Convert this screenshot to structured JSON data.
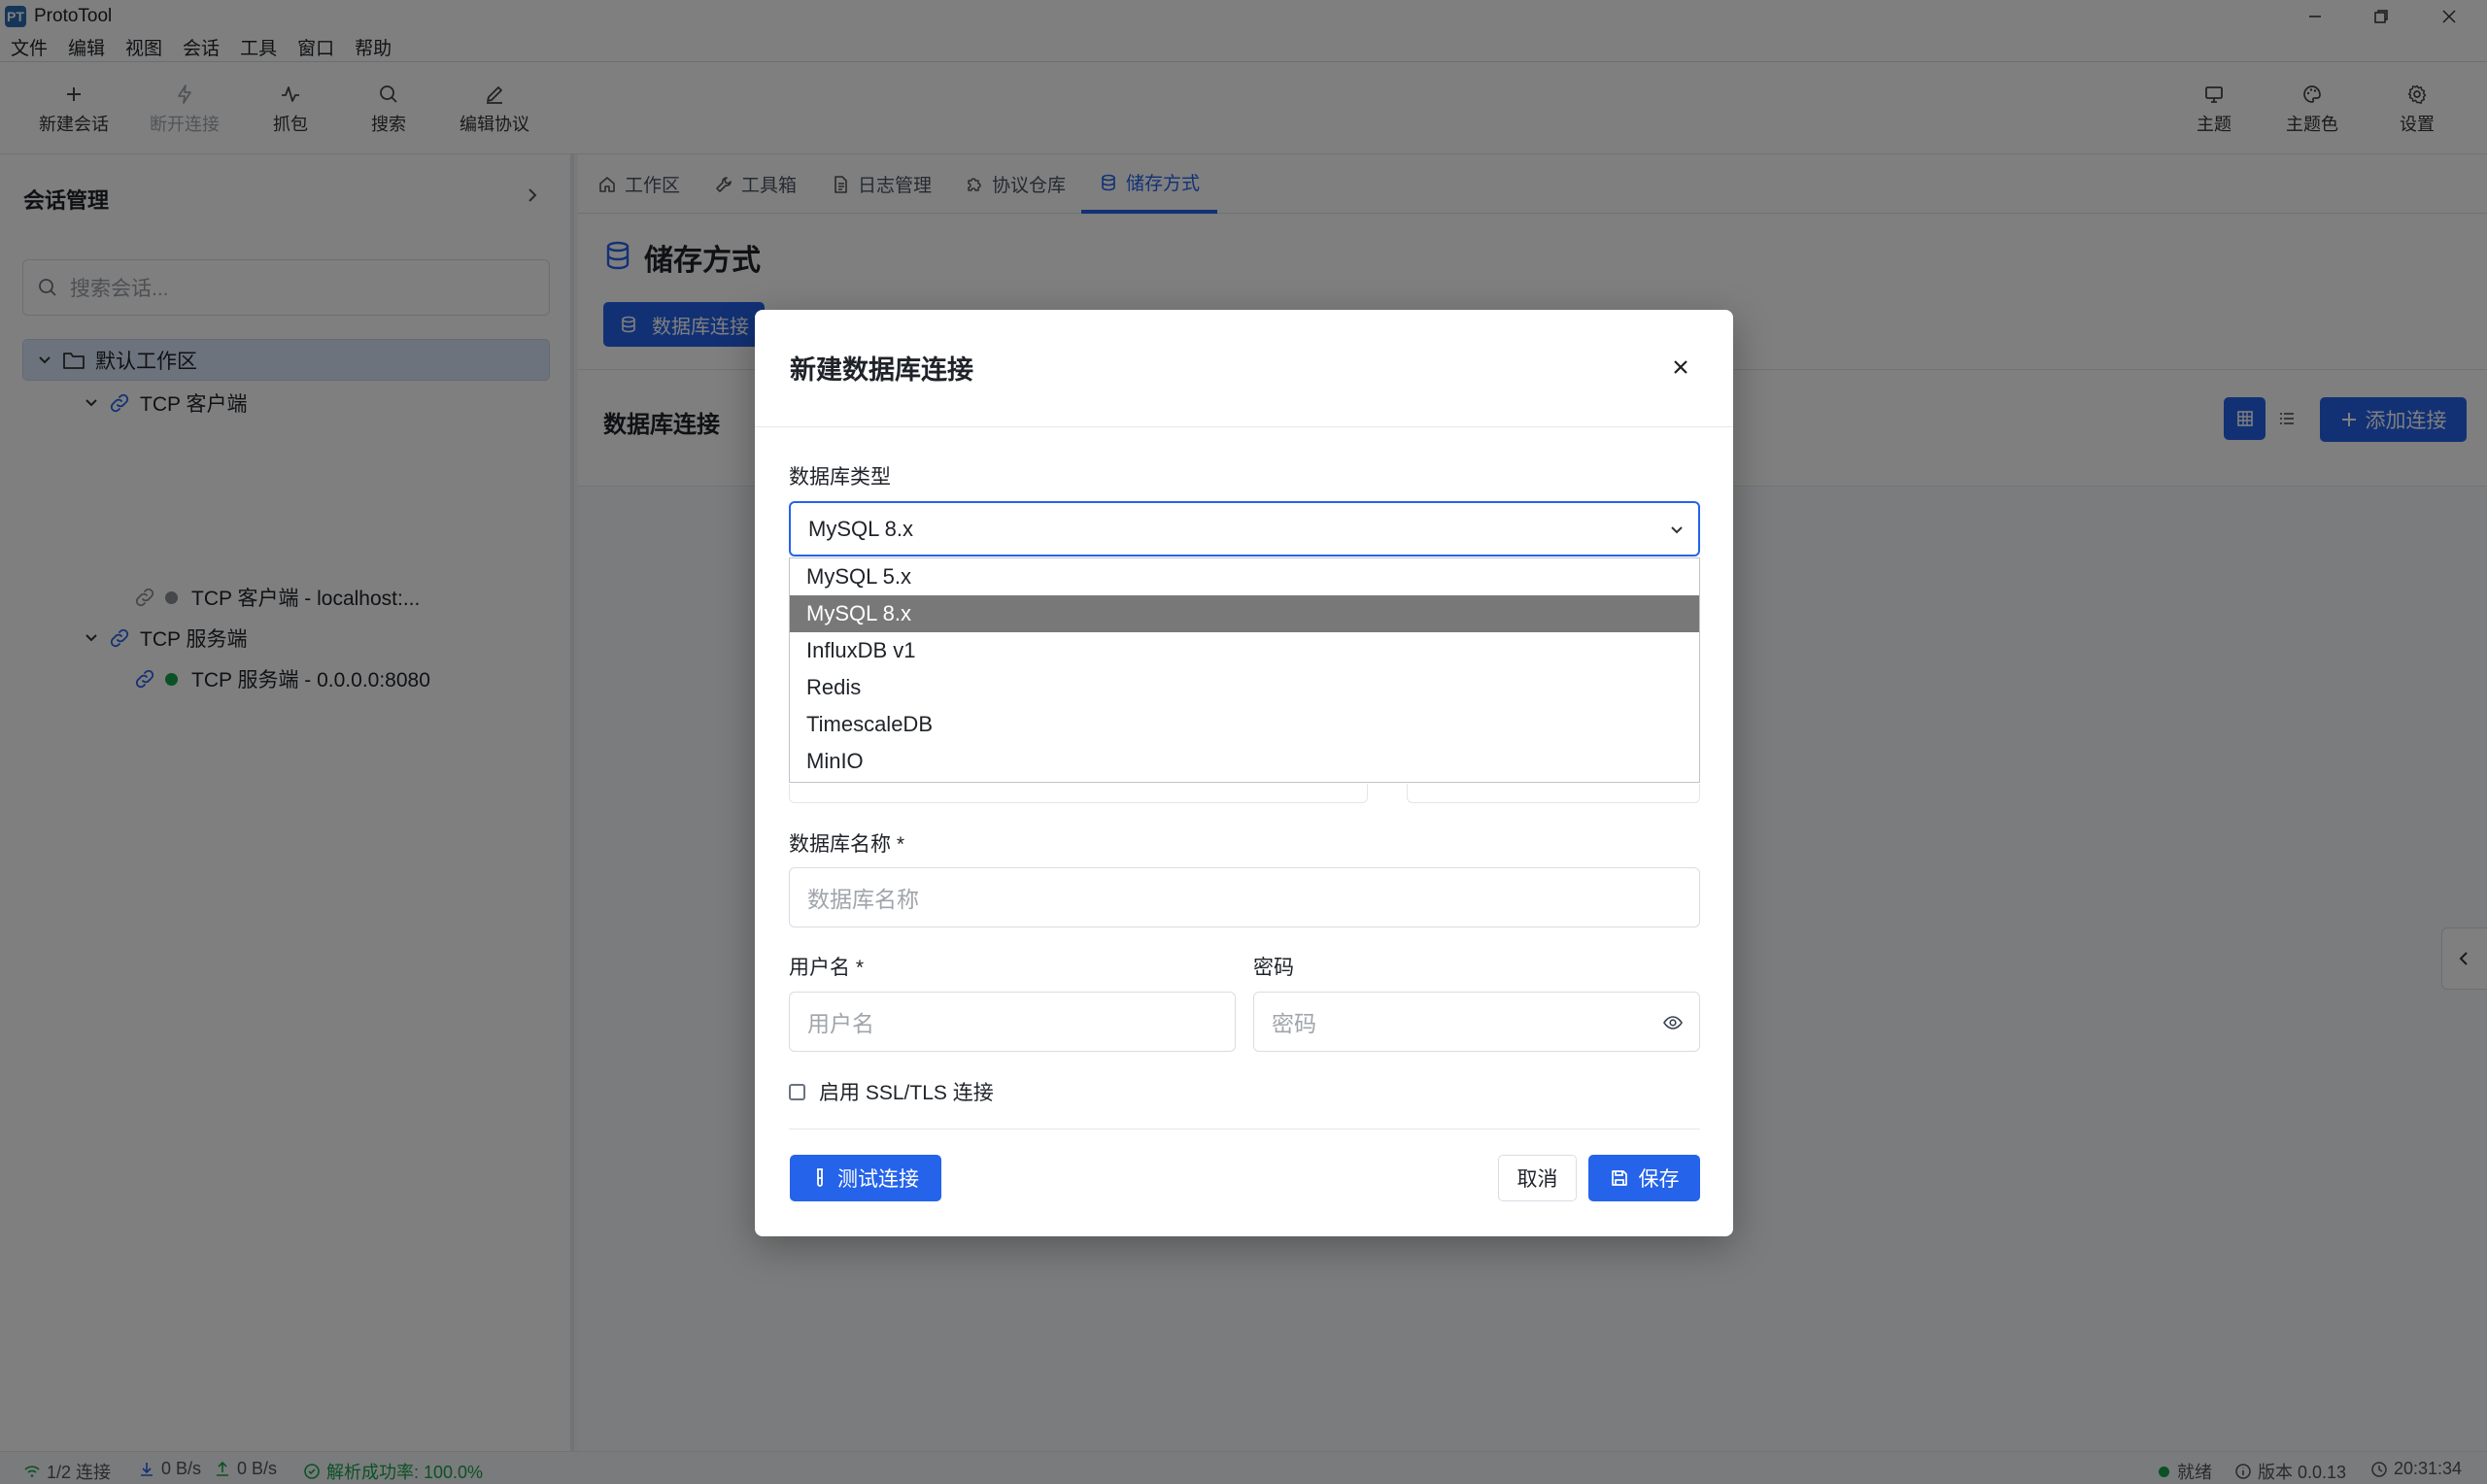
{
  "window": {
    "title": "ProtoTool",
    "logo": "PT",
    "controls": [
      "minimize-icon",
      "restore-icon",
      "close-icon"
    ]
  },
  "menu": [
    "文件",
    "编辑",
    "视图",
    "会话",
    "工具",
    "窗口",
    "帮助"
  ],
  "toolbar": {
    "new_session": "新建会话",
    "disconnect": "断开连接",
    "capture": "抓包",
    "search": "搜索",
    "edit_protocol": "编辑协议",
    "theme": "主题",
    "theme_color": "主题色",
    "settings": "设置"
  },
  "sidebar": {
    "title": "会话管理",
    "search_placeholder": "搜索会话...",
    "tree": {
      "root": "默认工作区",
      "client_group": "TCP 客户端",
      "client_item": "TCP 客户端 - localhost:...",
      "server_group": "TCP 服务端",
      "server_item": "TCP 服务端 - 0.0.0.0:8080"
    },
    "status_colors": {
      "client": "#8a8f96",
      "server": "#16a34a"
    }
  },
  "tabs": [
    "工作区",
    "工具箱",
    "日志管理",
    "协议仓库",
    "储存方式"
  ],
  "active_tab": "储存方式",
  "page": {
    "title": "储存方式",
    "subtab": "数据库连接",
    "section_title": "数据库连接",
    "add_button": "添加连接"
  },
  "modal": {
    "title": "新建数据库连接",
    "db_type_label": "数据库类型",
    "db_type_value": "MySQL 8.x",
    "options": [
      "MySQL 5.x",
      "MySQL 8.x",
      "InfluxDB v1",
      "Redis",
      "TimescaleDB",
      "MinIO"
    ],
    "selected_option": "MySQL 8.x",
    "db_name_label": "数据库名称 *",
    "db_name_placeholder": "数据库名称",
    "username_label": "用户名 *",
    "username_placeholder": "用户名",
    "password_label": "密码",
    "password_placeholder": "密码",
    "ssl_label": "启用 SSL/TLS 连接",
    "test_button": "测试连接",
    "cancel_button": "取消",
    "save_button": "保存"
  },
  "status": {
    "connections": "1/2 连接",
    "download": "0 B/s",
    "upload": "0 B/s",
    "parse_rate": "解析成功率: 100.0%",
    "ready": "就绪",
    "version": "版本 0.0.13",
    "time": "20:31:34"
  },
  "colors": {
    "accent": "#2563eb",
    "success": "#16a34a",
    "overlay": "rgba(0,0,0,0.5)"
  }
}
